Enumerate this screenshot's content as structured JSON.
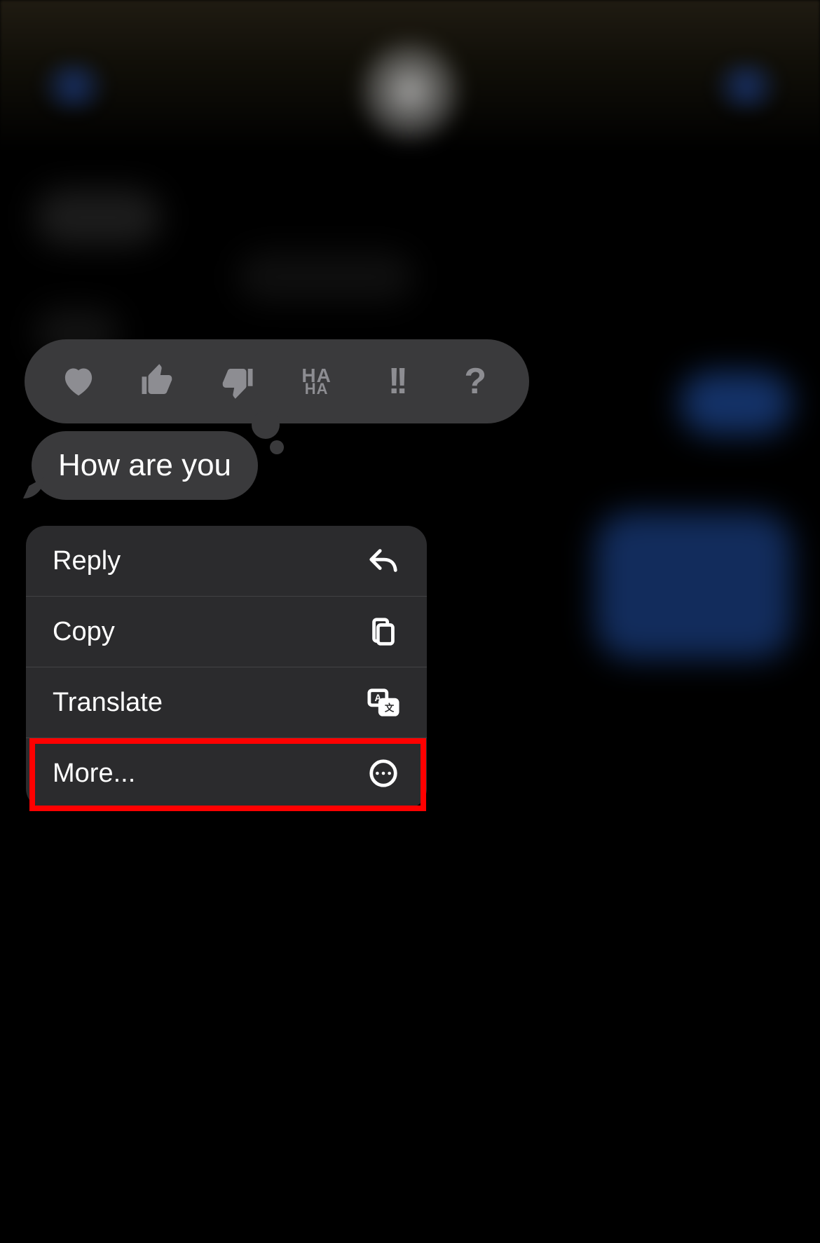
{
  "tapbacks": {
    "heart": "heart",
    "thumbs_up": "thumbs-up",
    "thumbs_down": "thumbs-down",
    "haha_top": "HA",
    "haha_bottom": "HA",
    "emphasize": "!!",
    "question": "?"
  },
  "message": {
    "text": "How are you"
  },
  "menu": {
    "reply": "Reply",
    "copy": "Copy",
    "translate": "Translate",
    "more": "More..."
  },
  "highlight": {
    "target": "more"
  }
}
